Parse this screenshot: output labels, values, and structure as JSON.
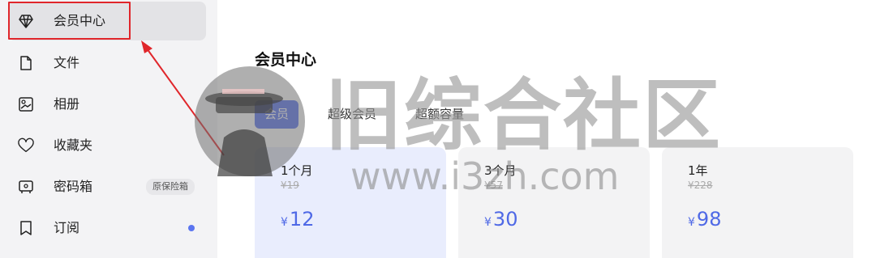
{
  "sidebar": {
    "items": [
      {
        "label": "会员中心",
        "icon": "diamond-icon",
        "active": true
      },
      {
        "label": "文件",
        "icon": "file-icon"
      },
      {
        "label": "相册",
        "icon": "photo-album-icon"
      },
      {
        "label": "收藏夹",
        "icon": "heart-icon"
      },
      {
        "label": "密码箱",
        "icon": "safe-box-icon",
        "badge": "原保险箱"
      },
      {
        "label": "订阅",
        "icon": "bookmark-icon",
        "dot": true
      }
    ]
  },
  "main": {
    "title": "会员中心",
    "tabs": [
      {
        "label": "会员",
        "active": true
      },
      {
        "label": "超级会员"
      },
      {
        "label": "超额容量"
      }
    ],
    "plans": [
      {
        "name": "1个月",
        "original_price": "¥19",
        "currency": "¥",
        "price": "12",
        "selected": true
      },
      {
        "name": "3个月",
        "original_price": "¥57",
        "currency": "¥",
        "price": "30"
      },
      {
        "name": "1年",
        "original_price": "¥228",
        "currency": "¥",
        "price": "98"
      }
    ]
  },
  "watermark": {
    "text": "旧综合社区",
    "url": "www.i3zh.com"
  },
  "colors": {
    "accent": "#5b75f0",
    "price": "#4f69e6",
    "annotation": "#e0262b",
    "sidebar_bg": "#f3f3f5"
  }
}
